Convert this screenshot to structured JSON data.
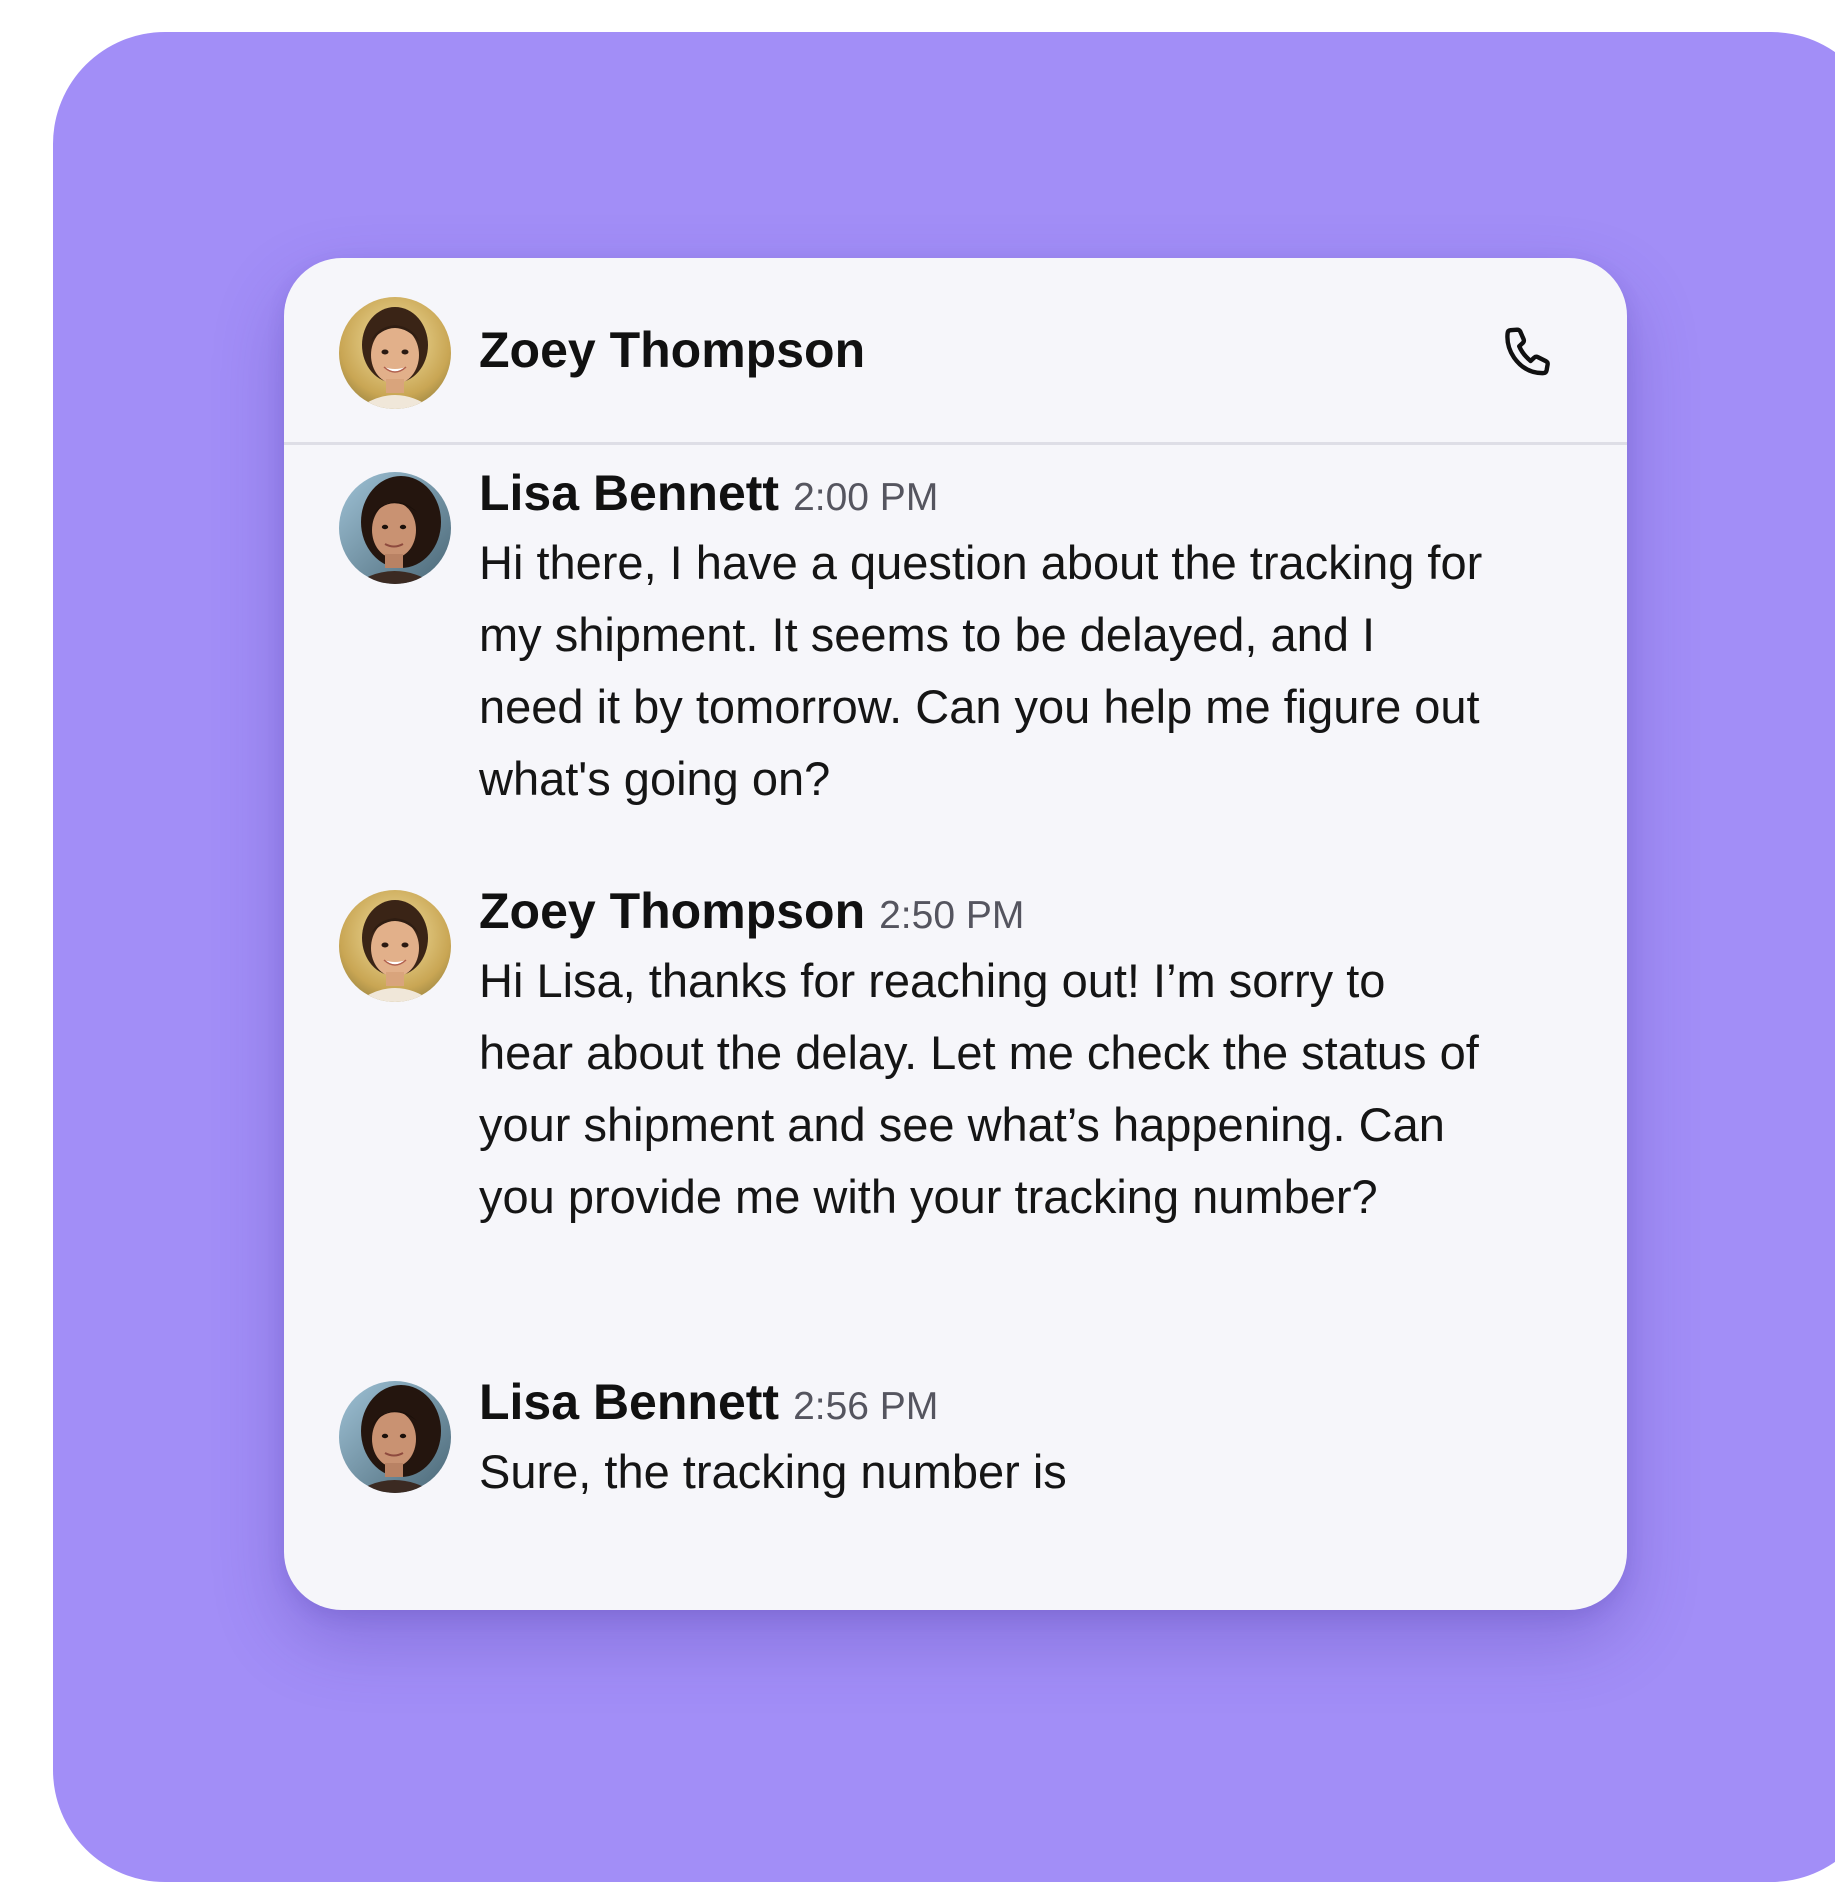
{
  "header": {
    "contact_name": "Zoey Thompson",
    "call_icon": "phone-icon"
  },
  "messages": [
    {
      "sender": "Lisa Bennett",
      "time": "2:00 PM",
      "text": "Hi there, I have a question about the tracking for my shipment. It seems to be delayed, and I need it by tomorrow. Can you help me figure out what's going on?"
    },
    {
      "sender": "Zoey Thompson",
      "time": "2:50 PM",
      "text": "Hi Lisa, thanks for reaching out! I’m sorry to hear about the delay. Let me check the status of your shipment and see what’s happening. Can you provide me with your tracking number?"
    },
    {
      "sender": "Lisa Bennett",
      "time": "2:56 PM",
      "text": "Sure, the tracking number is"
    }
  ],
  "colors": {
    "backdrop": "#a28ef7",
    "card": "#f6f6fa",
    "text": "#111111",
    "timestamp": "#55555f"
  }
}
